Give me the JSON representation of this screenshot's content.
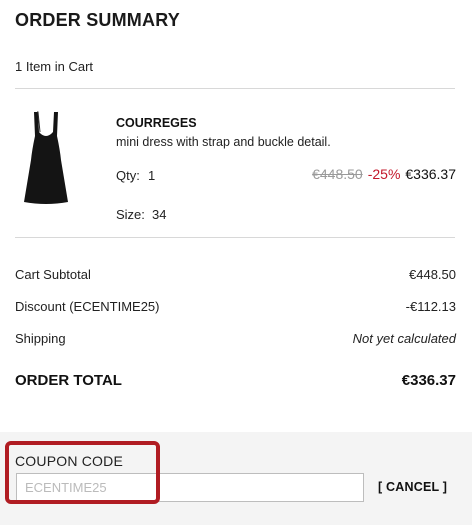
{
  "summary": {
    "title": "ORDER SUMMARY",
    "items_count": "1 Item in Cart"
  },
  "cart_item": {
    "image_icon": "black-strap-dress-thumbnail",
    "brand": "COURREGES",
    "description": "mini dress with strap and buckle detail.",
    "qty_label": "Qty:",
    "qty_value": "1",
    "price_original": "€448.50",
    "discount_percent": "-25%",
    "price_final": "€336.37",
    "size_label": "Size:",
    "size_value": "34"
  },
  "totals": {
    "subtotal_label": "Cart Subtotal",
    "subtotal_value": "€448.50",
    "discount_label": "Discount (ECENTIME25)",
    "discount_value": "-€112.13",
    "shipping_label": "Shipping",
    "shipping_value": "Not yet calculated",
    "order_total_label": "ORDER TOTAL",
    "order_total_value": "€336.37"
  },
  "coupon": {
    "label": "COUPON CODE",
    "input_value": "ECENTIME25",
    "cancel_label": "[ CANCEL ]"
  },
  "colors": {
    "discount_red": "#c3172a",
    "highlight_red": "#b01c22",
    "strikethrough_gray": "#9a9a9a"
  }
}
